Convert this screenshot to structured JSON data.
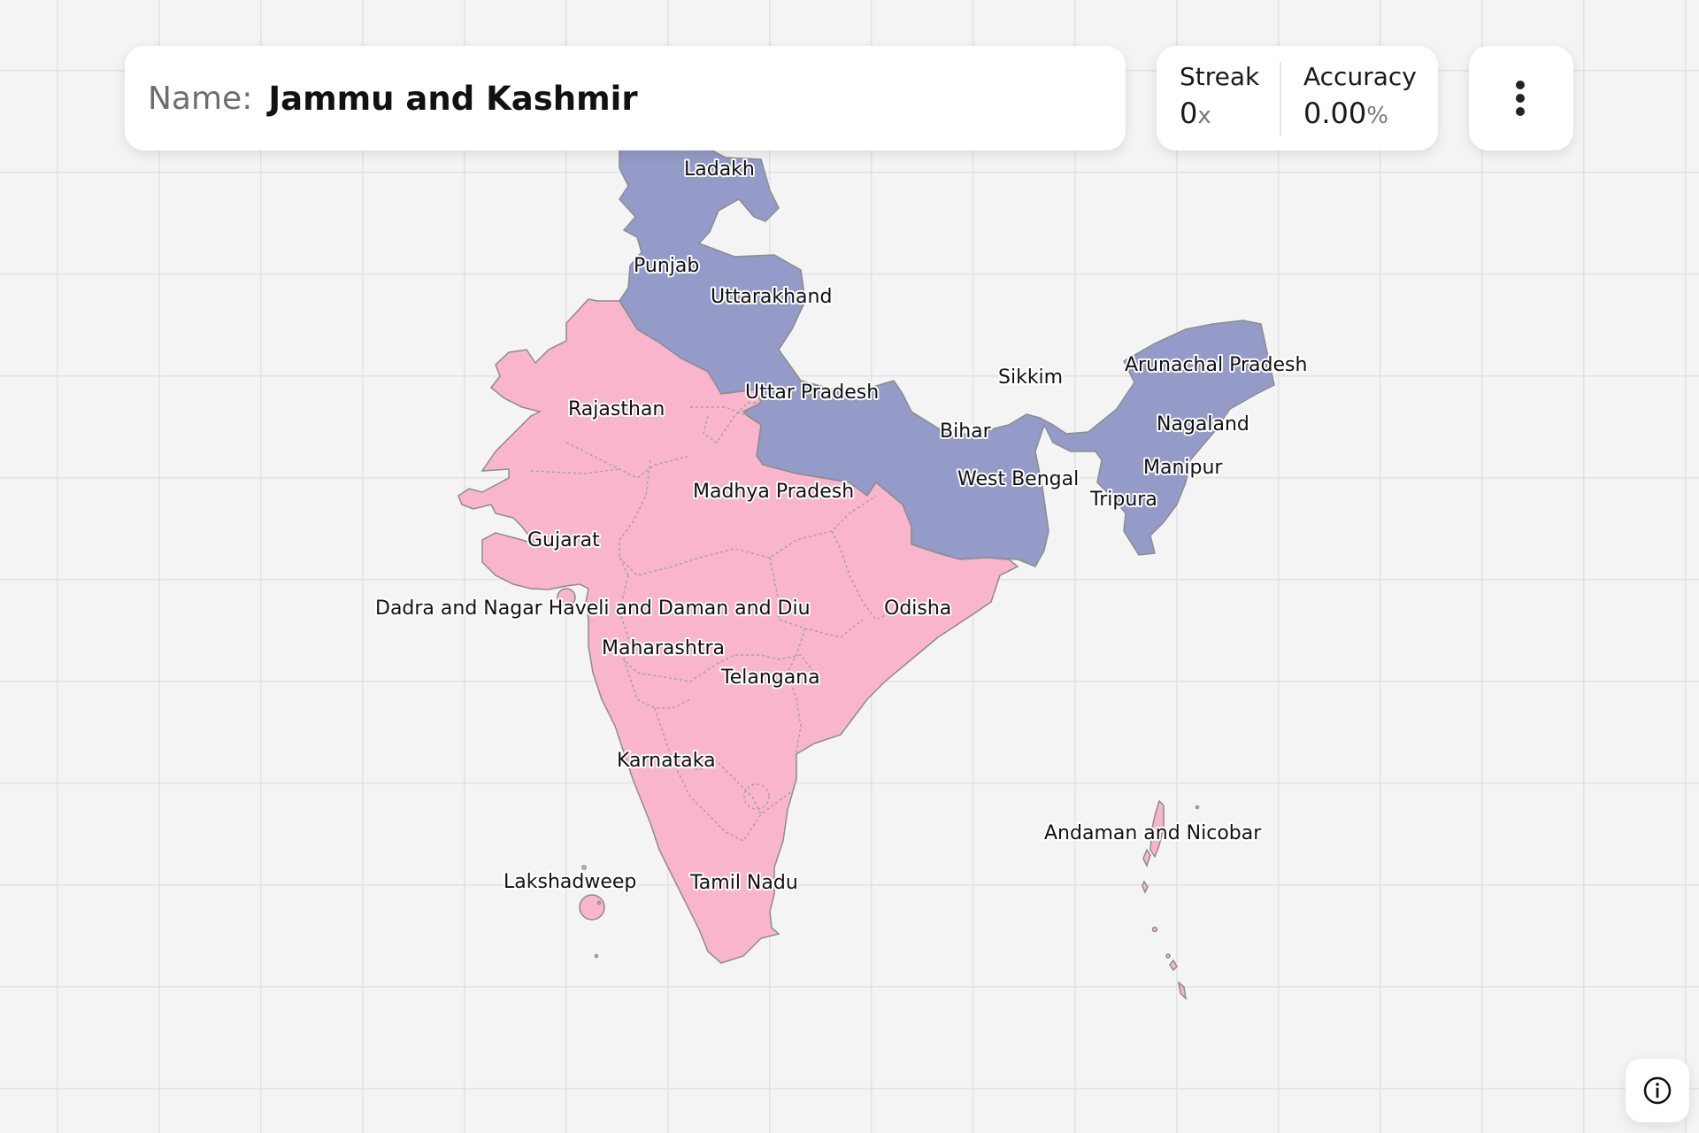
{
  "header": {
    "name_label": "Name:",
    "name_value": "Jammu and Kashmir"
  },
  "stats": {
    "streak_label": "Streak",
    "streak_value": "0",
    "streak_unit": "x",
    "accuracy_label": "Accuracy",
    "accuracy_value": "0.00",
    "accuracy_unit": "%"
  },
  "menu": {
    "icon": "more-vertical-icon"
  },
  "info": {
    "icon": "info-icon"
  },
  "colors": {
    "completed": "#949bc8",
    "remaining": "#f9b5cc",
    "background": "#f4f4f4",
    "grid": "#e2e2e2"
  },
  "map": {
    "labels": {
      "ladakh": "Ladakh",
      "punjab": "Punjab",
      "uttarakhand": "Uttarakhand",
      "rajasthan": "Rajasthan",
      "uttar_pradesh": "Uttar Pradesh",
      "sikkim": "Sikkim",
      "arunachal_pradesh": "Arunachal Pradesh",
      "nagaland": "Nagaland",
      "bihar": "Bihar",
      "manipur": "Manipur",
      "west_bengal": "West Bengal",
      "tripura": "Tripura",
      "madhya_pradesh": "Madhya Pradesh",
      "gujarat": "Gujarat",
      "dadra": "Dadra and Nagar Haveli and Daman and Diu",
      "odisha": "Odisha",
      "maharashtra": "Maharashtra",
      "telangana": "Telangana",
      "karnataka": "Karnataka",
      "andaman": "Andaman and Nicobar",
      "lakshadweep": "Lakshadweep",
      "tamil_nadu": "Tamil Nadu"
    }
  }
}
